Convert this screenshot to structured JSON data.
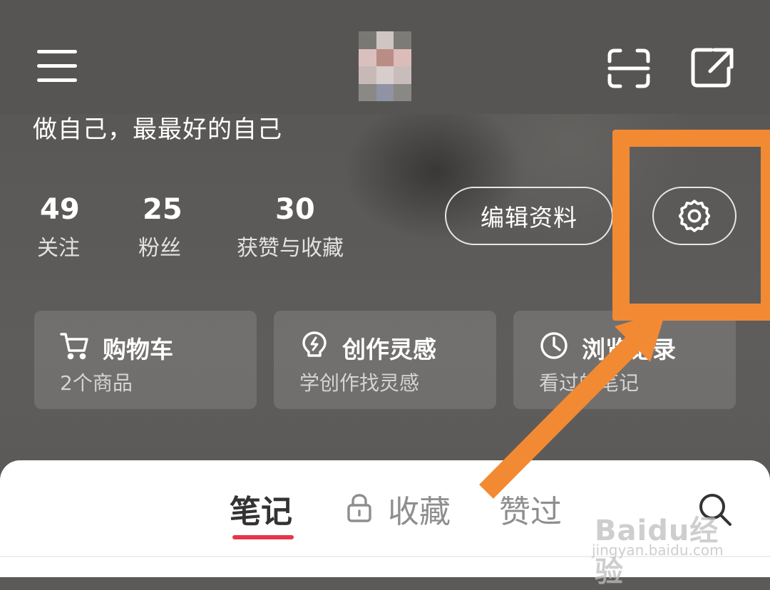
{
  "profile": {
    "bio": "做自己，最最好的自己"
  },
  "stats": [
    {
      "value": "49",
      "label": "关注"
    },
    {
      "value": "25",
      "label": "粉丝"
    },
    {
      "value": "30",
      "label": "获赞与收藏"
    }
  ],
  "buttons": {
    "edit_profile": "编辑资料"
  },
  "cards": [
    {
      "title": "购物车",
      "subtitle": "2个商品",
      "icon": "cart-icon"
    },
    {
      "title": "创作灵感",
      "subtitle": "学创作找灵感",
      "icon": "bulb-icon"
    },
    {
      "title": "浏览记录",
      "subtitle": "看过的笔记",
      "icon": "clock-icon"
    }
  ],
  "tabs": [
    {
      "label": "笔记",
      "active": true
    },
    {
      "label": "收藏",
      "active": false,
      "locked": true
    },
    {
      "label": "赞过",
      "active": false
    }
  ],
  "icons": {
    "menu": "menu-icon",
    "scan": "scan-icon",
    "share": "share-icon",
    "settings": "gear-icon",
    "search": "search-icon",
    "lock": "lock-icon"
  },
  "colors": {
    "highlight": "#f28a34",
    "tab_underline": "#e6354a"
  },
  "watermark": {
    "logo": "Baidu经验",
    "url": "jingyan.baidu.com"
  }
}
